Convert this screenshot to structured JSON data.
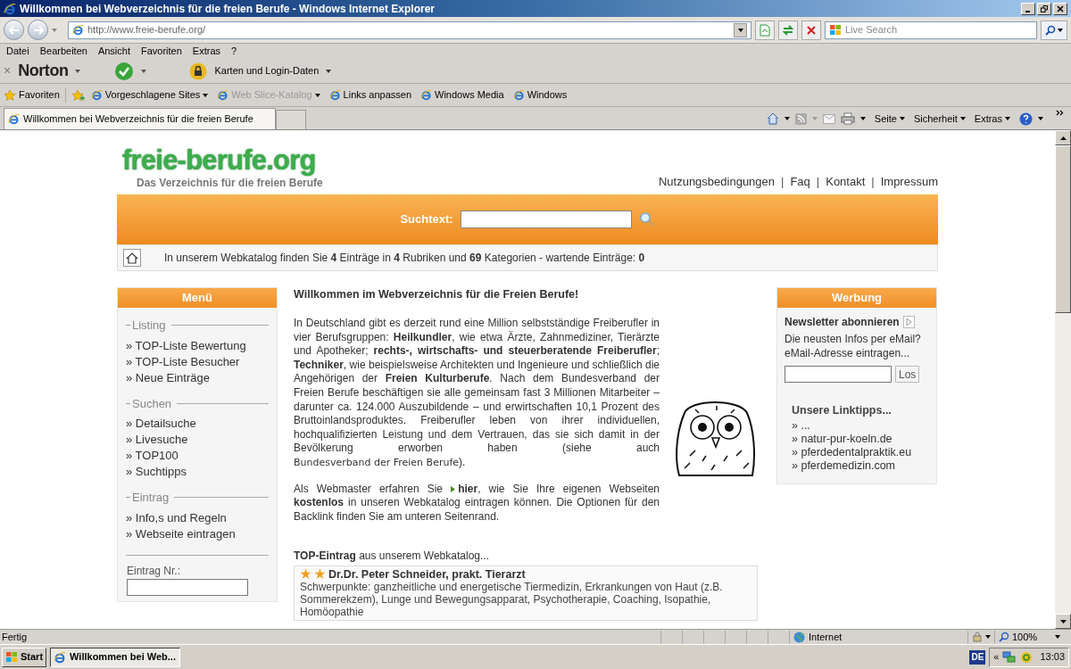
{
  "window": {
    "title": "Willkommen bei Webverzeichnis für die freien Berufe - Windows Internet Explorer"
  },
  "address_bar": {
    "url": "http://www.freie-berufe.org/"
  },
  "search_box": {
    "placeholder": "Live Search"
  },
  "menu_bar": [
    "Datei",
    "Bearbeiten",
    "Ansicht",
    "Favoriten",
    "Extras",
    "?"
  ],
  "norton_toolbar": {
    "close": "×",
    "brand": "Norton",
    "cards": "Karten und Login-Daten"
  },
  "favorites_bar": {
    "favorites": "Favoriten",
    "items": [
      {
        "label": "Vorgeschlagene Sites",
        "dropdown": true,
        "disabled": false
      },
      {
        "label": "Web Slice-Katalog",
        "dropdown": true,
        "disabled": true
      },
      {
        "label": "Links anpassen",
        "dropdown": false,
        "disabled": false
      },
      {
        "label": "Windows Media",
        "dropdown": false,
        "disabled": false
      },
      {
        "label": "Windows",
        "dropdown": false,
        "disabled": false
      }
    ]
  },
  "tabs": [
    {
      "label": "Willkommen bei Webverzeichnis für die freien Berufe",
      "selected": true
    }
  ],
  "command_bar": [
    "Seite",
    "Sicherheit",
    "Extras"
  ],
  "page": {
    "logo": "freie-berufe.org",
    "tagline": "Das Verzeichnis für die freien Berufe",
    "top_links": [
      "Nutzungsbedingungen",
      "Faq",
      "Kontakt",
      "Impressum"
    ],
    "separator": "|",
    "search_label": "Suchtext:",
    "stats": "In unserem Webkatalog finden Sie **4** Einträge in **4** Rubriken und **69** Kategorien - wartende Einträge: **0**",
    "menu": {
      "title": "Menü",
      "sections": [
        {
          "heading": "Listing",
          "items": [
            "» TOP-Liste Bewertung",
            "» TOP-Liste Besucher",
            "» Neue Einträge"
          ]
        },
        {
          "heading": "Suchen",
          "items": [
            "» Detailsuche",
            "» Livesuche",
            "» TOP100",
            "» Suchtipps"
          ]
        },
        {
          "heading": "Eintrag",
          "items": [
            "» Info,s und Regeln",
            "» Webseite eintragen"
          ]
        }
      ],
      "entry_label": "Eintrag Nr.:"
    },
    "welcome_title": "Willkommen im Webverzeichnis für die Freien Berufe!",
    "intro": {
      "text": "In Deutschland gibt es derzeit rund eine Million selbstständige Freiberufler in vier Berufsgruppen: **Heilkundler**, wie etwa Ärzte, Zahnmediziner, Tierärzte und Apotheker; **rechts-, wirtschafts- und steuerberatende Freiberufler**; **Techniker**, wie beispielsweise Architekten und Ingenieure und schließlich die Angehörigen der **Freien Kulturberufe**. Nach dem Bundesverband der Freien Berufe beschäftigen sie alle gemeinsam fast 3 Millionen Mitarbeiter – darunter ca. 124.000 Auszubildende – und erwirtschaften 10,1 Prozent des Bruttoinlandsproduktes. Freiberufler leben von ihrer individuellen, hochqualifizierten Leistung und dem Vertrauen, das sie sich damit in der Bevölkerung erworben haben (siehe auch",
      "link": "Bundesverband der Freien Berufe",
      "after": ")."
    },
    "webmaster": {
      "before": "Als Webmaster erfahren Sie",
      "link": "hier",
      "after": ", wie Sie Ihre eigenen Webseiten **kostenlos** in unseren Webkatalog eintragen können. Die Optionen für den Backlink finden Sie am unteren Seitenrand."
    },
    "top_entry": {
      "heading": "**TOP-Eintrag** aus unserem Webkatalog...",
      "badges": [
        {
          "kind": "star"
        },
        {
          "kind": "star"
        }
      ],
      "name": "Dr.Dr. Peter Schneider, prakt. Tierarzt",
      "text": "Schwerpunkte: ganzheitliche und energetische Tiermedizin, Erkrankungen von Haut (z.B. Sommerekzem), Lunge und Bewegungsapparat, Psychotherapie, Coaching, Isopathie, Homöopathie"
    },
    "ads": {
      "title": "Werbung",
      "newsletter": "Newsletter abonnieren",
      "newsletter_text": "Die neusten Infos per eMail? eMail-Adresse eintragen...",
      "button": "Los",
      "linktips_title": "Unsere Linktipps...",
      "links": [
        "» ...",
        "» natur-pur-koeln.de",
        "» pferdedentalpraktik.eu",
        "» pferdemedizin.com"
      ]
    }
  },
  "status_bar": {
    "text": "Fertig",
    "zone": "Internet",
    "zoom": "100%"
  },
  "taskbar": {
    "start": "Start",
    "tasks": [
      {
        "label": "Willkommen bei Web...",
        "selected": true
      }
    ],
    "language": "DE",
    "tray_collapse": "«",
    "clock": "13:03"
  }
}
